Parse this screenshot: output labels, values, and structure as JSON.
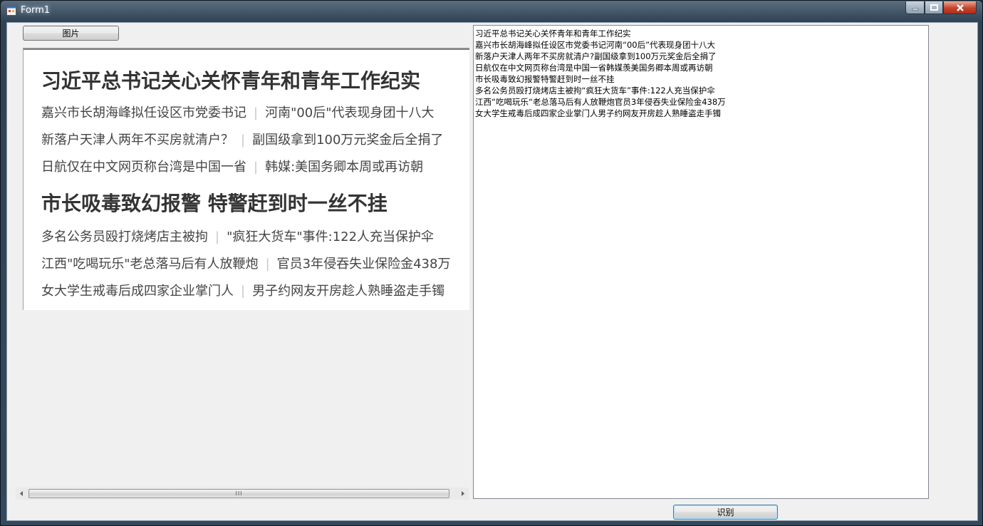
{
  "window": {
    "title": "Form1"
  },
  "toolbar": {
    "image_button": "图片",
    "recognize_button": "识别"
  },
  "picture": {
    "headline1": "习近平总书记关心关怀青年和青年工作纪实",
    "group1": [
      {
        "left": "嘉兴市长胡海峰拟任设区市党委书记",
        "right": "河南\"00后\"代表现身团十八大"
      },
      {
        "left": "新落户天津人两年不买房就清户？",
        "right": "副国级拿到100万元奖金后全捐了"
      },
      {
        "left": "日航仅在中文网页称台湾是中国一省",
        "right": "韩媒:美国务卿本周或再访朝"
      }
    ],
    "headline2": "市长吸毒致幻报警 特警赶到时一丝不挂",
    "group2": [
      {
        "left": "多名公务员殴打烧烤店主被拘",
        "right": "\"疯狂大货车\"事件:122人充当保护伞"
      },
      {
        "left": "江西\"吃喝玩乐\"老总落马后有人放鞭炮",
        "right": "官员3年侵吞失业保险金438万"
      },
      {
        "left": "女大学生戒毒后成四家企业掌门人",
        "right": "男子约网友开房趁人熟睡盗走手镯"
      }
    ]
  },
  "scrollbar": {
    "grip": "III"
  },
  "result_text": {
    "lines": [
      "习近平总书记关心关怀青年和青年工作纪实",
      "嘉兴市长胡海峰拟任设区市党委书记河南“00后”代表现身团十八大",
      "新落户天津人两年不买房就清户?副国级拿到100万元奖金后全捐了",
      "日航仅在中文网页称台湾是中国一省韩媒羡美国务卿本周或再访朝",
      "市长吸毒致幻报警特警赶到时一丝不挂",
      "多名公务员殴打烧烤店主被拘“疯狂大货车”事件:122人充当保护伞",
      "江西“吃喝玩乐“老总落马后有人放鞭炮官员3年侵吞失业保险金438万",
      "女大学生戒毒后成四家企业掌门人男子约网友开房趁人熟睡盗走手镯"
    ]
  }
}
